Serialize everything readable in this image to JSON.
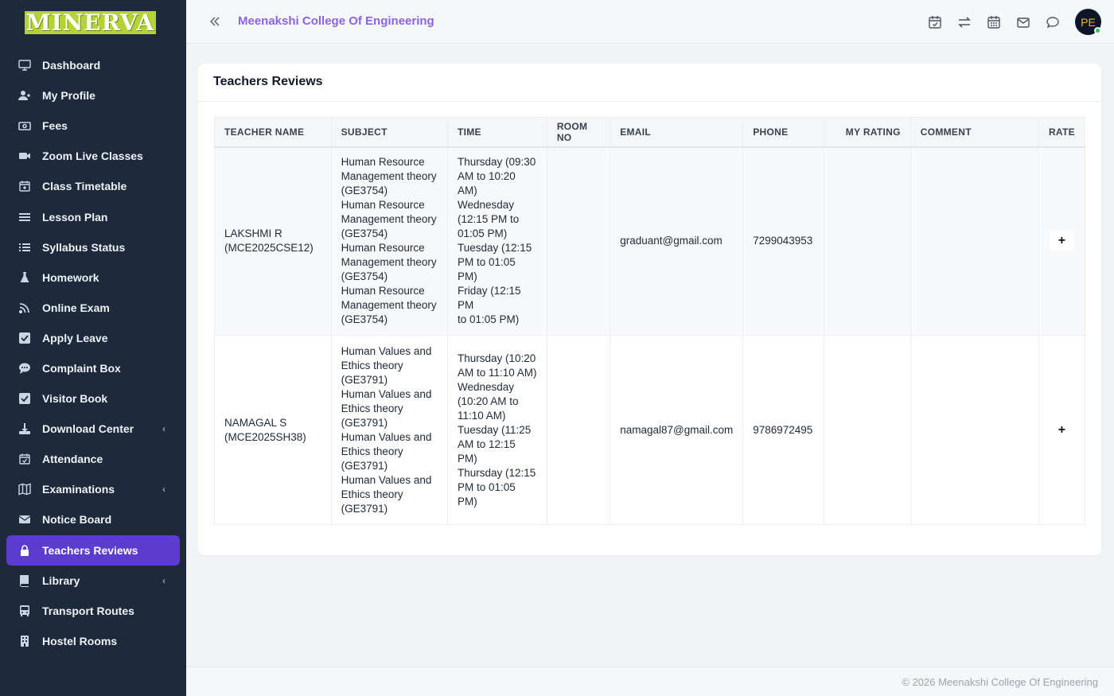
{
  "app": {
    "logo_text": "MINERVA",
    "college_name": "Meenakshi College Of Engineering",
    "avatar_initials": "PE"
  },
  "sidebar": {
    "items": [
      {
        "label": "Dashboard",
        "icon": "monitor-icon"
      },
      {
        "label": "My Profile",
        "icon": "user-plus-icon"
      },
      {
        "label": "Fees",
        "icon": "money-icon"
      },
      {
        "label": "Zoom Live Classes",
        "icon": "video-icon"
      },
      {
        "label": "Class Timetable",
        "icon": "calendar-plus-icon"
      },
      {
        "label": "Lesson Plan",
        "icon": "list-icon"
      },
      {
        "label": "Syllabus Status",
        "icon": "list-ordered-icon"
      },
      {
        "label": "Homework",
        "icon": "flask-icon"
      },
      {
        "label": "Online Exam",
        "icon": "rss-icon"
      },
      {
        "label": "Apply Leave",
        "icon": "check-square-icon"
      },
      {
        "label": "Complaint Box",
        "icon": "comment-icon"
      },
      {
        "label": "Visitor Book",
        "icon": "check-square-icon"
      },
      {
        "label": "Download Center",
        "icon": "download-icon"
      },
      {
        "label": "Attendance",
        "icon": "calendar-check-icon"
      },
      {
        "label": "Examinations",
        "icon": "map-icon"
      },
      {
        "label": "Notice Board",
        "icon": "envelope-icon"
      },
      {
        "label": "Teachers Reviews",
        "icon": "lock-user-icon"
      },
      {
        "label": "Library",
        "icon": "book-icon"
      },
      {
        "label": "Transport Routes",
        "icon": "bus-icon"
      },
      {
        "label": "Hostel Rooms",
        "icon": "building-icon"
      }
    ]
  },
  "page": {
    "title": "Teachers Reviews"
  },
  "table": {
    "headers": [
      "TEACHER NAME",
      "SUBJECT",
      "TIME",
      "ROOM NO",
      "EMAIL",
      "PHONE",
      "MY RATING",
      "COMMENT",
      "RATE"
    ],
    "rows": [
      {
        "teacher": [
          "LAKSHMI R",
          "(MCE2025CSE12)"
        ],
        "subject": [
          "Human Resource",
          "Management theory",
          "(GE3754)",
          "Human Resource",
          "Management theory",
          "(GE3754)",
          "Human Resource",
          "Management theory",
          "(GE3754)",
          "Human Resource",
          "Management theory",
          "(GE3754)"
        ],
        "time": [
          "Thursday (09:30",
          "AM to 10:20 AM)",
          "Wednesday",
          "(12:15 PM to",
          "01:05 PM)",
          "Tuesday (12:15",
          "PM to 01:05 PM)",
          "Friday (12:15 PM",
          "to 01:05 PM)"
        ],
        "room": "",
        "email": "graduant@gmail.com",
        "phone": "7299043953",
        "rating": "",
        "comment": "",
        "rate": "+"
      },
      {
        "teacher": [
          "NAMAGAL S",
          "(MCE2025SH38)"
        ],
        "subject": [
          "Human Values and",
          "Ethics theory",
          "(GE3791)",
          "Human Values and",
          "Ethics theory",
          "(GE3791)",
          "Human Values and",
          "Ethics theory",
          "(GE3791)",
          "Human Values and",
          "Ethics theory",
          "(GE3791)"
        ],
        "time": [
          "Thursday (10:20",
          "AM to 11:10 AM)",
          "Wednesday",
          "(10:20 AM to",
          "11:10 AM)",
          "Tuesday (11:25",
          "AM to 12:15 PM)",
          "Thursday (12:15",
          "PM to 01:05 PM)"
        ],
        "room": "",
        "email": "namagal87@gmail.com",
        "phone": "9786972495",
        "rating": "",
        "comment": "",
        "rate": "+"
      }
    ]
  },
  "footer": {
    "text": "© 2026 Meenakshi College Of Engineering"
  },
  "colors": {
    "sidebar_bg": "#1e293b",
    "active_item": "#5b3ccf",
    "college_title": "#8a63e6",
    "logo_bg": "#b5d334"
  }
}
